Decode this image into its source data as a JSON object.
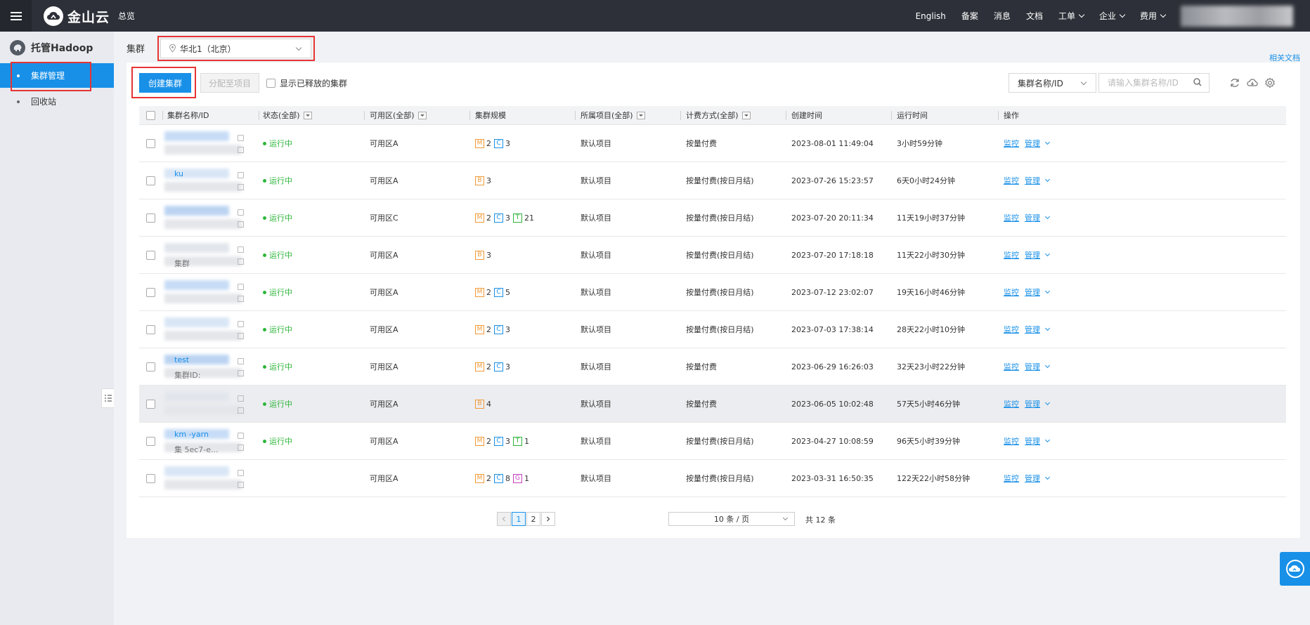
{
  "topbar": {
    "logo_text": "金山云",
    "overview": "总览",
    "nav": [
      {
        "label": "English",
        "dropdown": false
      },
      {
        "label": "备案",
        "dropdown": false
      },
      {
        "label": "消息",
        "dropdown": false
      },
      {
        "label": "文档",
        "dropdown": false
      },
      {
        "label": "工单",
        "dropdown": true
      },
      {
        "label": "企业",
        "dropdown": true
      },
      {
        "label": "费用",
        "dropdown": true
      }
    ]
  },
  "sidebar": {
    "title": "托管Hadoop",
    "items": [
      {
        "label": "集群管理",
        "active": true
      },
      {
        "label": "回收站",
        "active": false
      }
    ]
  },
  "region": {
    "label": "集群",
    "value": "华北1（北京）"
  },
  "related_docs": "相关文档",
  "toolbar": {
    "create_label": "创建集群",
    "assign_label": "分配至项目",
    "show_released_label": "显示已释放的集群",
    "search_type": "集群名称/ID",
    "search_placeholder": "请输入集群名称/ID"
  },
  "table": {
    "headers": {
      "name": "集群名称/ID",
      "status": "状态(全部)",
      "zone": "可用区(全部)",
      "scale": "集群规模",
      "project": "所属项目(全部)",
      "billing": "计费方式(全部)",
      "created": "创建时间",
      "runtime": "运行时间",
      "ops": "操作"
    },
    "monitor_label": "监控",
    "manage_label": "管理",
    "rows": [
      {
        "name": "",
        "sub": "",
        "status": "运行中",
        "zone": "可用区A",
        "scale": [
          {
            "t": "M",
            "n": "2"
          },
          {
            "t": "C",
            "n": "3"
          }
        ],
        "project": "默认项目",
        "billing": "按量付费",
        "created": "2023-08-01 11:49:04",
        "runtime": "3小时59分钟"
      },
      {
        "name": "ku",
        "sub": "",
        "status": "运行中",
        "zone": "可用区A",
        "scale": [
          {
            "t": "B",
            "n": "3"
          }
        ],
        "project": "默认项目",
        "billing": "按量付费(按日月结)",
        "created": "2023-07-26 15:23:57",
        "runtime": "6天0小时24分钟"
      },
      {
        "name": "",
        "sub": "",
        "status": "运行中",
        "zone": "可用区C",
        "scale": [
          {
            "t": "M",
            "n": "2"
          },
          {
            "t": "C",
            "n": "3"
          },
          {
            "t": "T",
            "n": "21"
          }
        ],
        "project": "默认项目",
        "billing": "按量付费(按日月结)",
        "created": "2023-07-20 20:11:34",
        "runtime": "11天19小时37分钟"
      },
      {
        "name": "",
        "sub": "集群",
        "status": "运行中",
        "zone": "可用区A",
        "scale": [
          {
            "t": "B",
            "n": "3"
          }
        ],
        "project": "默认项目",
        "billing": "按量付费(按日月结)",
        "created": "2023-07-20 17:18:18",
        "runtime": "11天22小时30分钟"
      },
      {
        "name": "",
        "sub": "",
        "status": "运行中",
        "zone": "可用区A",
        "scale": [
          {
            "t": "M",
            "n": "2"
          },
          {
            "t": "C",
            "n": "5"
          }
        ],
        "project": "默认项目",
        "billing": "按量付费(按日月结)",
        "created": "2023-07-12 23:02:07",
        "runtime": "19天16小时46分钟"
      },
      {
        "name": "",
        "sub": "",
        "status": "运行中",
        "zone": "可用区A",
        "scale": [
          {
            "t": "M",
            "n": "2"
          },
          {
            "t": "C",
            "n": "3"
          }
        ],
        "project": "默认项目",
        "billing": "按量付费(按日月结)",
        "created": "2023-07-03 17:38:14",
        "runtime": "28天22小时10分钟"
      },
      {
        "name": "test",
        "sub": "集群ID:",
        "status": "运行中",
        "zone": "可用区A",
        "scale": [
          {
            "t": "M",
            "n": "2"
          },
          {
            "t": "C",
            "n": "3"
          }
        ],
        "project": "默认项目",
        "billing": "按量付费",
        "created": "2023-06-29 16:26:03",
        "runtime": "32天23小时22分钟"
      },
      {
        "name": "",
        "sub": "",
        "status": "运行中",
        "zone": "可用区A",
        "scale": [
          {
            "t": "B",
            "n": "4"
          }
        ],
        "project": "默认项目",
        "billing": "按量付费",
        "created": "2023-06-05 10:02:48",
        "runtime": "57天5小时46分钟"
      },
      {
        "name": "km      -yarn",
        "sub": "集      5ec7-e...",
        "status": "运行中",
        "zone": "可用区A",
        "scale": [
          {
            "t": "M",
            "n": "2"
          },
          {
            "t": "C",
            "n": "3"
          },
          {
            "t": "T",
            "n": "1"
          }
        ],
        "project": "默认项目",
        "billing": "按量付费(按日月结)",
        "created": "2023-04-27 10:08:59",
        "runtime": "96天5小时39分钟"
      },
      {
        "name": "",
        "sub": "",
        "status": "",
        "zone": "可用区A",
        "scale": [
          {
            "t": "M",
            "n": "2"
          },
          {
            "t": "C",
            "n": "8"
          },
          {
            "t": "G",
            "n": "1"
          }
        ],
        "project": "默认项目",
        "billing": "按量付费(按日月结)",
        "created": "2023-03-31 16:50:35",
        "runtime": "122天22小时58分钟"
      }
    ]
  },
  "pagination": {
    "pages": [
      "1",
      "2"
    ],
    "current": "1",
    "page_size": "10 条 / 页",
    "total": "共 12 条"
  },
  "colors": {
    "accent": "#1890e8",
    "topbar": "#2d3038",
    "running": "#2db53a",
    "highlight_box": "#e63434"
  }
}
